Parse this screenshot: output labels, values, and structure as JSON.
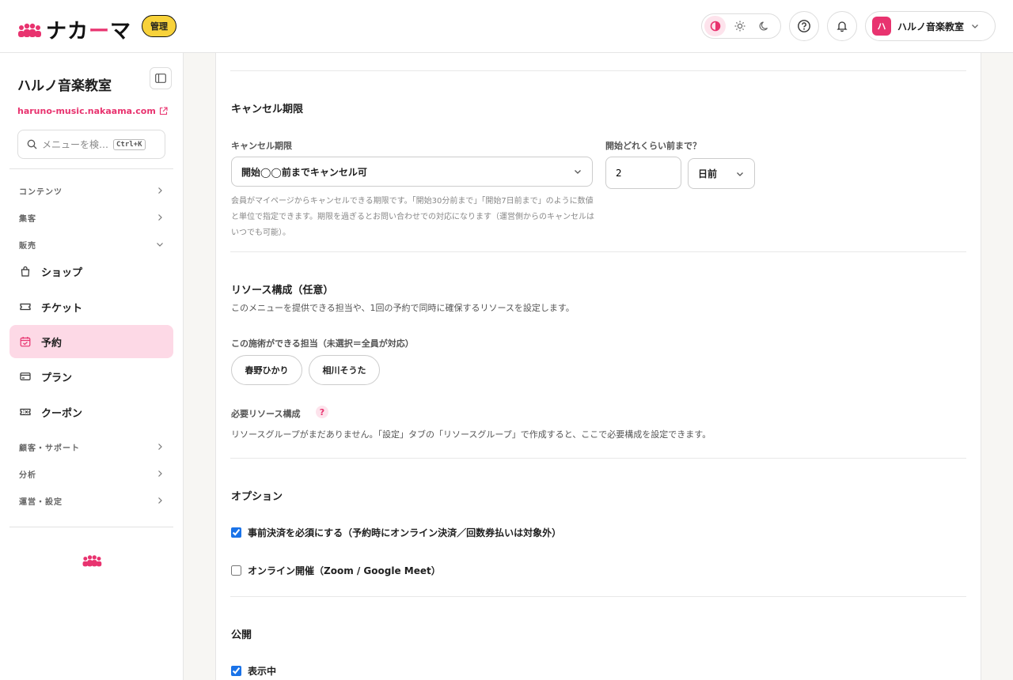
{
  "header": {
    "logo_text_1": "ナカ",
    "logo_text_dash": "ー",
    "logo_text_2": "マ",
    "admin_badge": "管理",
    "account_avatar": "ハ",
    "account_name": "ハルノ音楽教室"
  },
  "sidebar": {
    "site_title": "ハルノ音楽教室",
    "site_url": "haruno-music.nakaama.com",
    "search_placeholder": "メニューを検…",
    "search_shortcut": "Ctrl+K",
    "groups": {
      "contents": "コンテンツ",
      "marketing": "集客",
      "sales": "販売",
      "customers": "顧客・サポート",
      "analytics": "分析",
      "operations": "運営・設定"
    },
    "items": {
      "shop": "ショップ",
      "ticket": "チケット",
      "booking": "予約",
      "plan": "プラン",
      "coupon": "クーポン"
    }
  },
  "cancel": {
    "section_title": "キャンセル期限",
    "field_label": "キャンセル期限",
    "select_value": "開始◯◯前までキャンセル可",
    "help": "会員がマイページからキャンセルできる期限です。「開始30分前まで」「開始7日前まで」のように数値と単位で指定できます。期限を過ぎるとお問い合わせでの対応になります（運営側からのキャンセルはいつでも可能）。",
    "before_label": "開始どれくらい前まで？",
    "before_value": "2",
    "unit_value": "日前"
  },
  "resources": {
    "section_title": "リソース構成（任意）",
    "description": "このメニューを提供できる担当や、1回の予約で同時に確保するリソースを設定します。",
    "staff_label": "この施術ができる担当（未選択＝全員が対応）",
    "staff": [
      "春野ひかり",
      "相川そうた"
    ],
    "required_label": "必要リソース構成",
    "required_help_icon": "?",
    "required_desc": "リソースグループがまだありません。「設定」タブの「リソースグループ」で作成すると、ここで必要構成を設定できます。"
  },
  "options": {
    "section_title": "オプション",
    "prepay_label": "事前決済を必須にする（予約時にオンライン決済／回数券払いは対象外）",
    "prepay_checked": true,
    "online_label": "オンライン開催（Zoom / Google Meet）",
    "online_checked": false
  },
  "publish": {
    "section_title": "公開",
    "visible_label": "表示中",
    "visible_checked": true
  },
  "colors": {
    "accent": "#e8336f",
    "badge_yellow": "#f8d23a",
    "active_bg": "#fdd9e6"
  }
}
